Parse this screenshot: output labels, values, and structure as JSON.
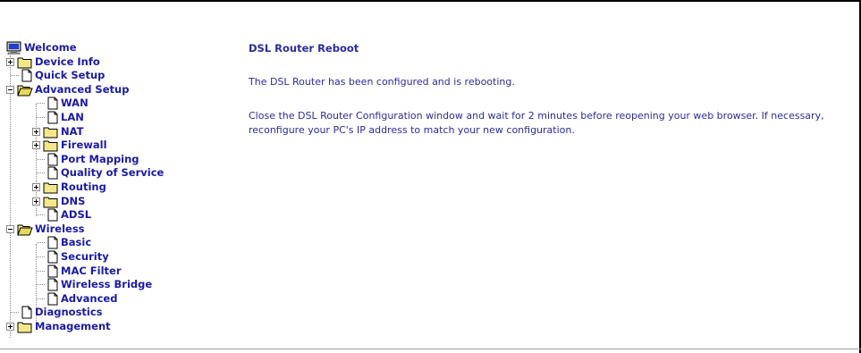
{
  "tree": {
    "welcome": "Welcome",
    "device_info": "Device Info",
    "quick_setup": "Quick Setup",
    "advanced_setup": "Advanced Setup",
    "wan": "WAN",
    "lan": "LAN",
    "nat": "NAT",
    "firewall": "Firewall",
    "port_mapping": "Port Mapping",
    "qos": "Quality of Service",
    "routing": "Routing",
    "dns": "DNS",
    "adsl": "ADSL",
    "wireless": "Wireless",
    "basic": "Basic",
    "security": "Security",
    "mac_filter": "MAC Filter",
    "wireless_bridge": "Wireless Bridge",
    "advanced": "Advanced",
    "diagnostics": "Diagnostics",
    "management": "Management"
  },
  "content": {
    "title": "DSL Router Reboot",
    "message1": "The DSL Router has been configured and is rebooting.",
    "message2": "Close the DSL Router Configuration window and wait for 2 minutes before reopening your web browser. If necessary, reconfigure your PC's IP address to match your new configuration."
  },
  "colors": {
    "link": "#1a1aa6",
    "text": "#2b2ba0",
    "folder": "#f3e78a",
    "folder_open": "#e8d85a"
  }
}
